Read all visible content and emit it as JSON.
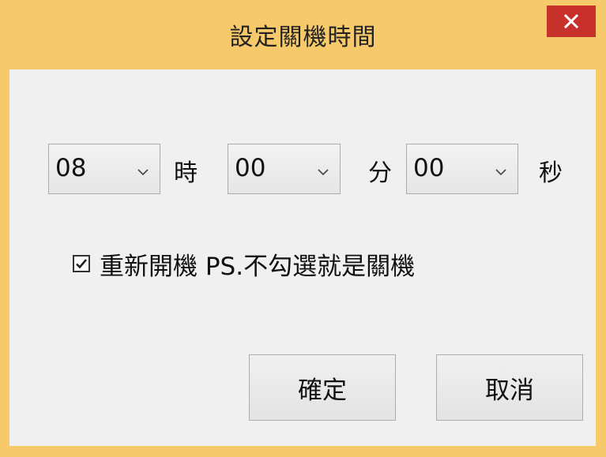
{
  "window": {
    "title": "設定關機時間",
    "close_icon": "close-icon"
  },
  "time": {
    "hour": {
      "value": "08",
      "unit": "時"
    },
    "minute": {
      "value": "00",
      "unit": "分"
    },
    "second": {
      "value": "00",
      "unit": "秒"
    }
  },
  "reboot": {
    "checked": true,
    "label": "重新開機 PS.不勾選就是關機"
  },
  "buttons": {
    "ok_label": "確定",
    "cancel_label": "取消"
  },
  "colors": {
    "frame": "#F6C96A",
    "close_button": "#C8312B",
    "client": "#F0F0F0"
  }
}
